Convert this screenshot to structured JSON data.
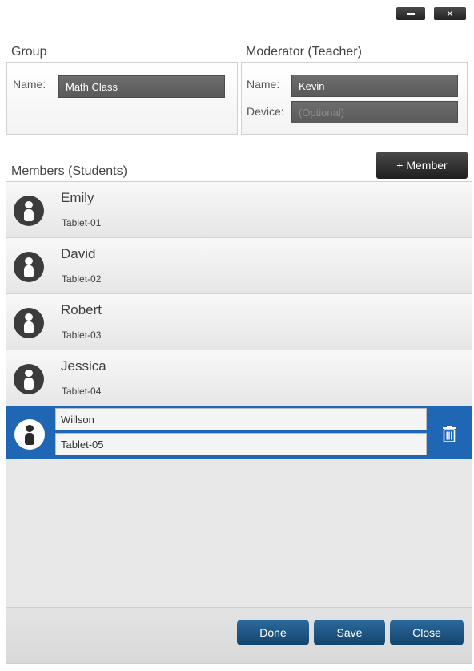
{
  "window": {
    "minimize_icon": "minimize-icon",
    "close_label": "✕"
  },
  "group": {
    "title": "Group",
    "name_label": "Name:",
    "name_value": "Math Class"
  },
  "moderator": {
    "title": "Moderator (Teacher)",
    "name_label": "Name:",
    "name_value": "Kevin",
    "device_label": "Device:",
    "device_placeholder": "(Optional)"
  },
  "members": {
    "title": "Members (Students)",
    "add_label": "+ Member",
    "items": [
      {
        "name": "Emily",
        "device": "Tablet-01"
      },
      {
        "name": "David",
        "device": "Tablet-02"
      },
      {
        "name": "Robert",
        "device": "Tablet-03"
      },
      {
        "name": "Jessica",
        "device": "Tablet-04"
      },
      {
        "name": "Willson",
        "device": "Tablet-05",
        "selected": true
      }
    ]
  },
  "footer": {
    "done_label": "Done",
    "save_label": "Save",
    "close_label": "Close"
  },
  "colors": {
    "selected_row": "#1f67b5",
    "footer_button": "#1a5585",
    "dark_button": "#2a2a2a"
  }
}
